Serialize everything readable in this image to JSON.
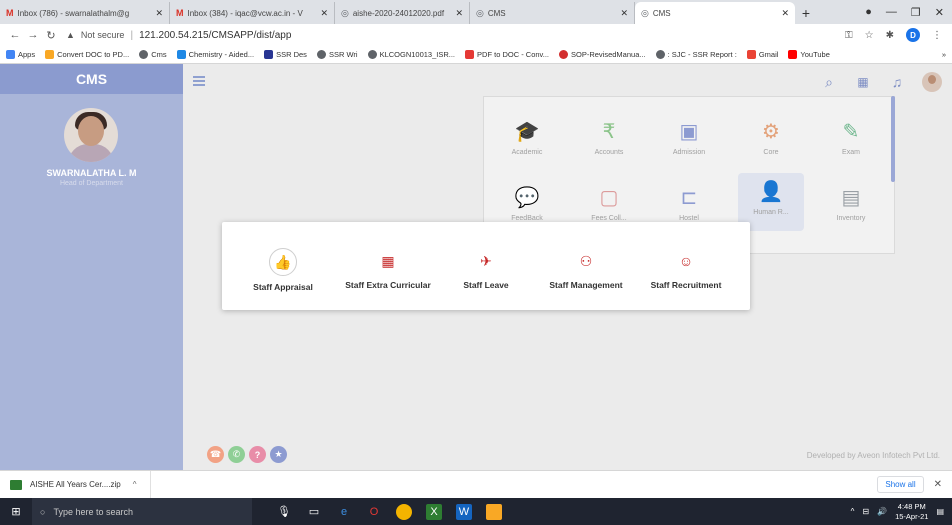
{
  "browser": {
    "tabs": [
      {
        "label": "Inbox (786) - swarnalathalm@g",
        "icon": "gmail-icon",
        "active": false
      },
      {
        "label": "Inbox (384) - iqac@vcw.ac.in - V",
        "icon": "gmail-icon",
        "active": false
      },
      {
        "label": "aishe-2020-24012020.pdf",
        "icon": "chrome-icon",
        "active": false
      },
      {
        "label": "CMS",
        "icon": "chrome-icon",
        "active": false
      },
      {
        "label": "CMS",
        "icon": "chrome-icon",
        "active": true
      }
    ],
    "new_tab": "+",
    "url_warning": "Not secure",
    "url": "121.200.54.215/CMSAPP/dist/app",
    "profile_initial": "D",
    "bookmarks": [
      {
        "label": "Apps",
        "color": "#4285f4"
      },
      {
        "label": "Convert DOC to PD...",
        "color": "#f9a825"
      },
      {
        "label": "Cms",
        "color": "#5f6368"
      },
      {
        "label": "Chemistry - Aided...",
        "color": "#1e88e5"
      },
      {
        "label": "SSR Des",
        "color": "#283593"
      },
      {
        "label": "SSR Wri",
        "color": "#5f6368"
      },
      {
        "label": "KLCOGN10013_ISR...",
        "color": "#5f6368"
      },
      {
        "label": "PDF to DOC - Conv...",
        "color": "#e53935"
      },
      {
        "label": "SOP-RevisedManua...",
        "color": "#d32f2f"
      },
      {
        "label": ": SJC - SSR Report :",
        "color": "#5f6368"
      },
      {
        "label": "Gmail",
        "color": "#ea4335"
      },
      {
        "label": "YouTube",
        "color": "#ff0000"
      }
    ],
    "bookmarks_more": "»"
  },
  "app": {
    "brand": "CMS",
    "user": {
      "name": "SWARNALATHA L. M",
      "role": "Head of Department"
    },
    "modules": [
      {
        "label": "Academic",
        "icon": "graduation-cap-icon",
        "glyph": "🎓",
        "color": "#c98a8a"
      },
      {
        "label": "Accounts",
        "icon": "rupee-icon",
        "glyph": "₹",
        "color": "#8bc48a"
      },
      {
        "label": "Admission",
        "icon": "id-card-icon",
        "glyph": "▣",
        "color": "#8d9bd1"
      },
      {
        "label": "Core",
        "icon": "gear-icon",
        "glyph": "⚙",
        "color": "#e3a27a"
      },
      {
        "label": "Exam",
        "icon": "pencil-icon",
        "glyph": "✎",
        "color": "#6fb78e"
      },
      {
        "label": "FeedBack",
        "icon": "chat-icon",
        "glyph": "💬",
        "color": "#d4b073"
      },
      {
        "label": "Fees Coll...",
        "icon": "briefcase-icon",
        "glyph": "▢",
        "color": "#dc9a9a"
      },
      {
        "label": "Hostel",
        "icon": "bed-icon",
        "glyph": "⊏",
        "color": "#8d9bd1"
      },
      {
        "label": "Human R...",
        "icon": "user-add-icon",
        "glyph": "👤",
        "color": "#8d9bd1"
      },
      {
        "label": "Inventory",
        "icon": "archive-icon",
        "glyph": "▤",
        "color": "#9aa0a6"
      }
    ],
    "popup": [
      {
        "label": "Staff Appraisal",
        "icon": "thumbs-up-icon",
        "glyph": "👍"
      },
      {
        "label": "Staff Extra Curricular",
        "icon": "qr-icon",
        "glyph": "▦"
      },
      {
        "label": "Staff Leave",
        "icon": "leave-icon",
        "glyph": "✈"
      },
      {
        "label": "Staff Management",
        "icon": "org-chart-icon",
        "glyph": "⚇"
      },
      {
        "label": "Staff Recruitment",
        "icon": "recruit-icon",
        "glyph": "☺"
      }
    ],
    "footer_credit": "Developed by Aveon Infotech Pvt Ltd."
  },
  "downloads": {
    "file": "AISHE All Years Cer....zip",
    "caret": "^",
    "show_all": "Show all"
  },
  "taskbar": {
    "search_placeholder": "Type here to search",
    "time": "4:48 PM",
    "date": "15-Apr-21"
  }
}
